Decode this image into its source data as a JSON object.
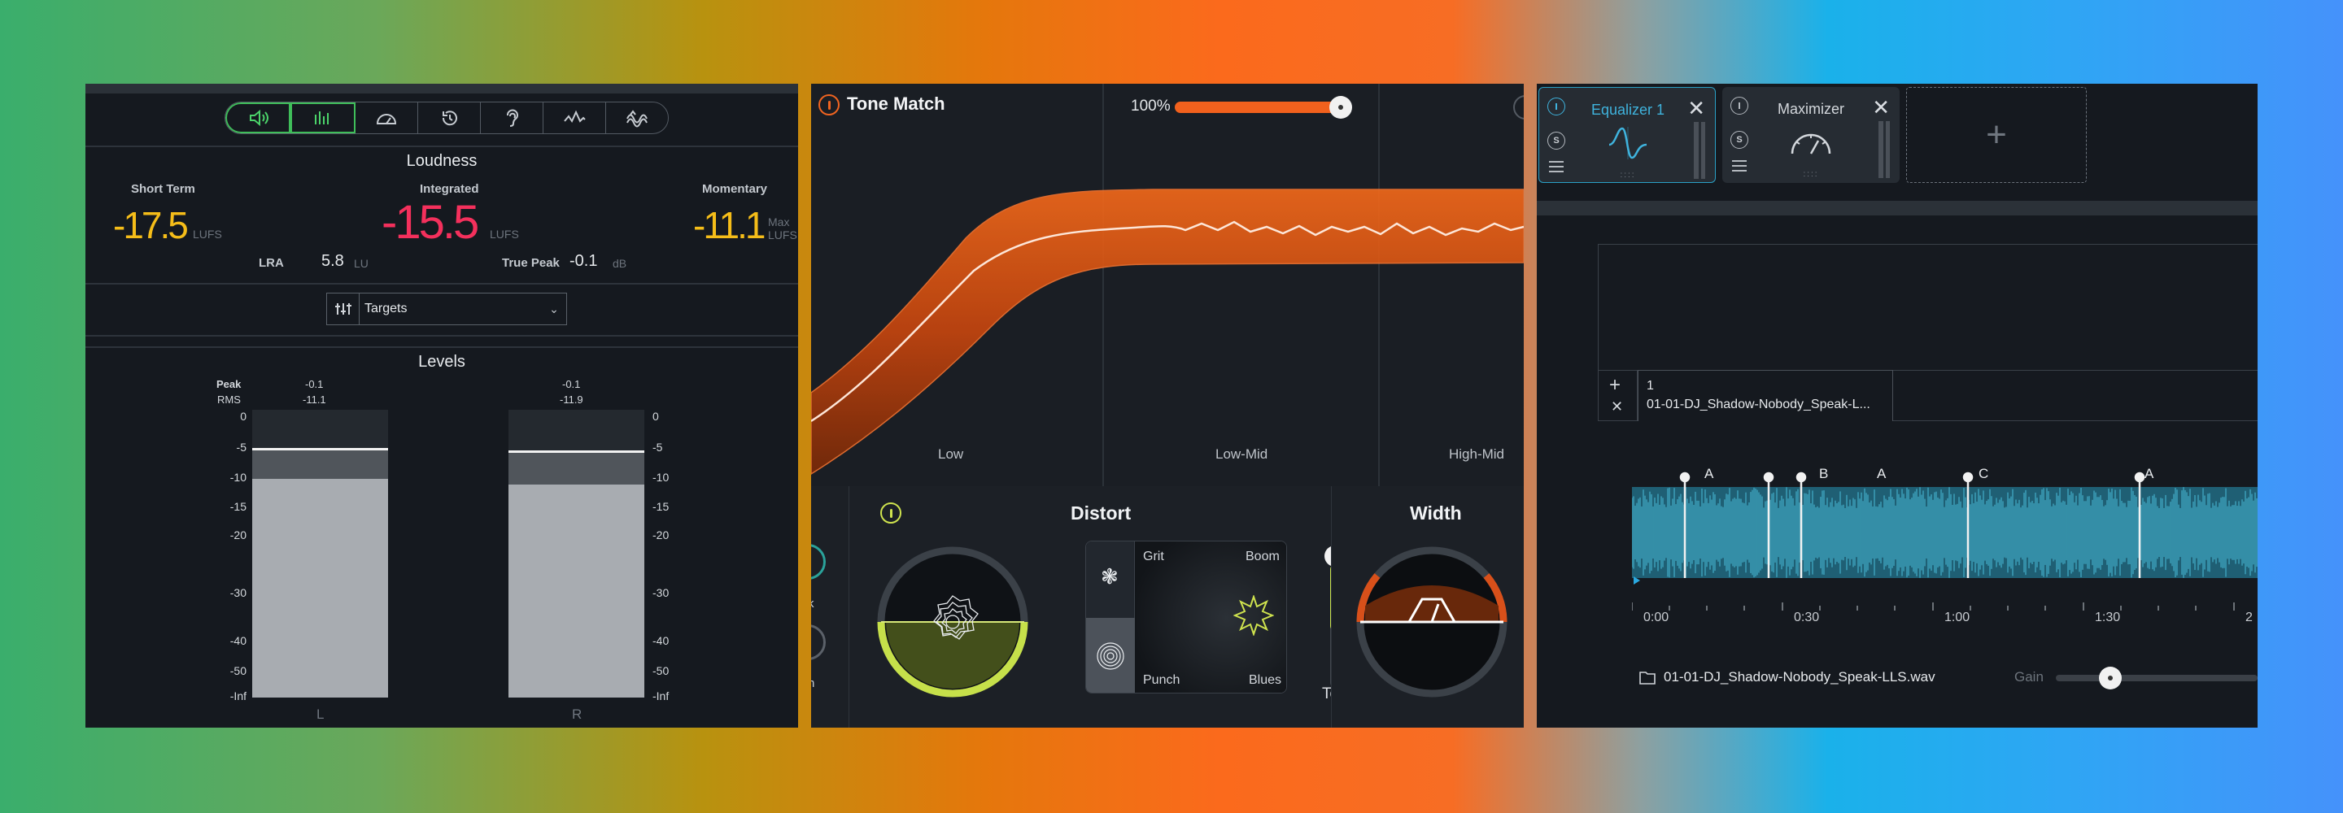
{
  "loudness_panel": {
    "toolbar_icons": [
      "speaker-icon",
      "meters-icon",
      "gauge-icon",
      "history-icon",
      "ear-icon",
      "waveform-icon",
      "spectrum-icon"
    ],
    "loudness_title": "Loudness",
    "short_term": {
      "label": "Short Term",
      "value": "-17.5",
      "unit": "LUFS"
    },
    "integrated": {
      "label": "Integrated",
      "value": "-15.5",
      "unit": "LUFS"
    },
    "momentary": {
      "label": "Momentary",
      "value": "-11.1",
      "unit_line1": "Max",
      "unit_line2": "LUFS"
    },
    "lra": {
      "label": "LRA",
      "value": "5.8",
      "unit": "LU"
    },
    "true_peak": {
      "label": "True Peak",
      "value": "-0.1",
      "unit": "dB"
    },
    "targets_label": "Targets",
    "levels_title": "Levels",
    "peak_label": "Peak",
    "rms_label": "RMS",
    "left": {
      "channel": "L",
      "peak": "-0.1",
      "rms": "-11.1",
      "rms_level_pct": 76,
      "peak_level_pct": 86
    },
    "right": {
      "channel": "R",
      "peak": "-0.1",
      "rms": "-11.9",
      "rms_level_pct": 74,
      "peak_level_pct": 85
    },
    "scale": [
      "0",
      "-5",
      "-10",
      "-15",
      "-20",
      "-30",
      "-40",
      "-50",
      "-Inf"
    ]
  },
  "tone_panel": {
    "title": "Tone Match",
    "amount": "100%",
    "amount_value": 1.0,
    "bands": [
      "Low",
      "Low-Mid",
      "High-Mid"
    ],
    "distort_title": "Distort",
    "pad_labels": {
      "top_left": "Grit",
      "top_right": "Boom",
      "bottom_left": "Punch",
      "bottom_right": "Blues"
    },
    "tone_label": "Tone",
    "width_title": "Width",
    "left_cut_fragments": {
      "a": "k",
      "b": "n"
    },
    "colors": {
      "accent": "#f2611d",
      "distort": "#cfe34e"
    }
  },
  "chain_panel": {
    "modules": [
      {
        "name": "Equalizer 1",
        "active": true
      },
      {
        "name": "Maximizer",
        "active": false
      }
    ],
    "solo_label": "S",
    "tab": {
      "number": "1",
      "title": "01-01-DJ_Shadow-Nobody_Speak-L..."
    },
    "markers": [
      "A",
      "B",
      "A",
      "C",
      "A"
    ],
    "times": [
      "0:00",
      "0:30",
      "1:00",
      "1:30",
      "2"
    ],
    "file_name": "01-01-DJ_Shadow-Nobody_Speak-LLS.wav",
    "gain_label": "Gain",
    "gain_value": 0.27
  }
}
